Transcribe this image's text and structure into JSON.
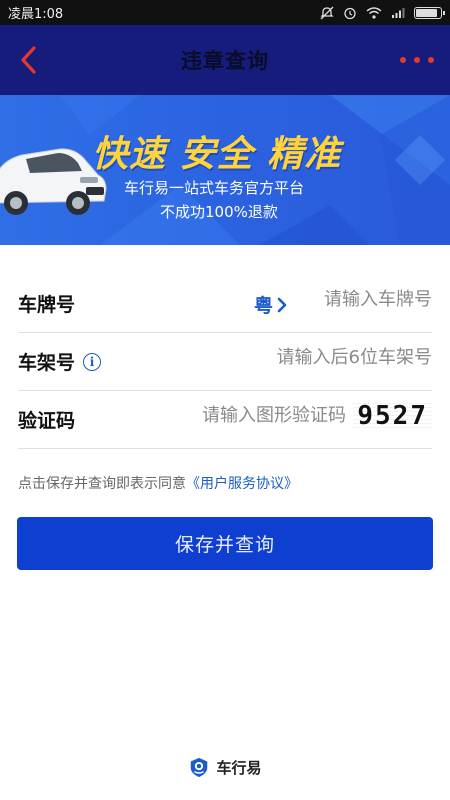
{
  "status_bar": {
    "time": "凌晨1:08",
    "icons": [
      "mute-icon",
      "alarm-icon",
      "wifi-icon",
      "signal-icon",
      "battery-icon"
    ]
  },
  "nav": {
    "title": "违章查询",
    "back_icon": "chevron-left-icon",
    "more_icon": "more-dots-icon"
  },
  "banner": {
    "headline": "快速 安全 精准",
    "subline1": "车行易一站式车务官方平台",
    "subline2": "不成功100%退款"
  },
  "form": {
    "plate": {
      "label": "车牌号",
      "province": "粤",
      "placeholder": "请输入车牌号"
    },
    "frame": {
      "label": "车架号",
      "info_icon": "i",
      "placeholder": "请输入后6位车架号"
    },
    "captcha": {
      "label": "验证码",
      "placeholder": "请输入图形验证码",
      "image_text": "9527"
    }
  },
  "agreement": {
    "prefix": "点击保存并查询即表示同意",
    "link": "《用户服务协议》"
  },
  "submit_label": "保存并查询",
  "footer": {
    "brand": "车行易",
    "logo_icon": "chexingyi-logo-icon"
  },
  "colors": {
    "nav_bg": "#161c7c",
    "accent": "#0f3fd1",
    "link": "#1b5cc9",
    "headline": "#ffd43b",
    "more_dots": "#e23b2e"
  }
}
